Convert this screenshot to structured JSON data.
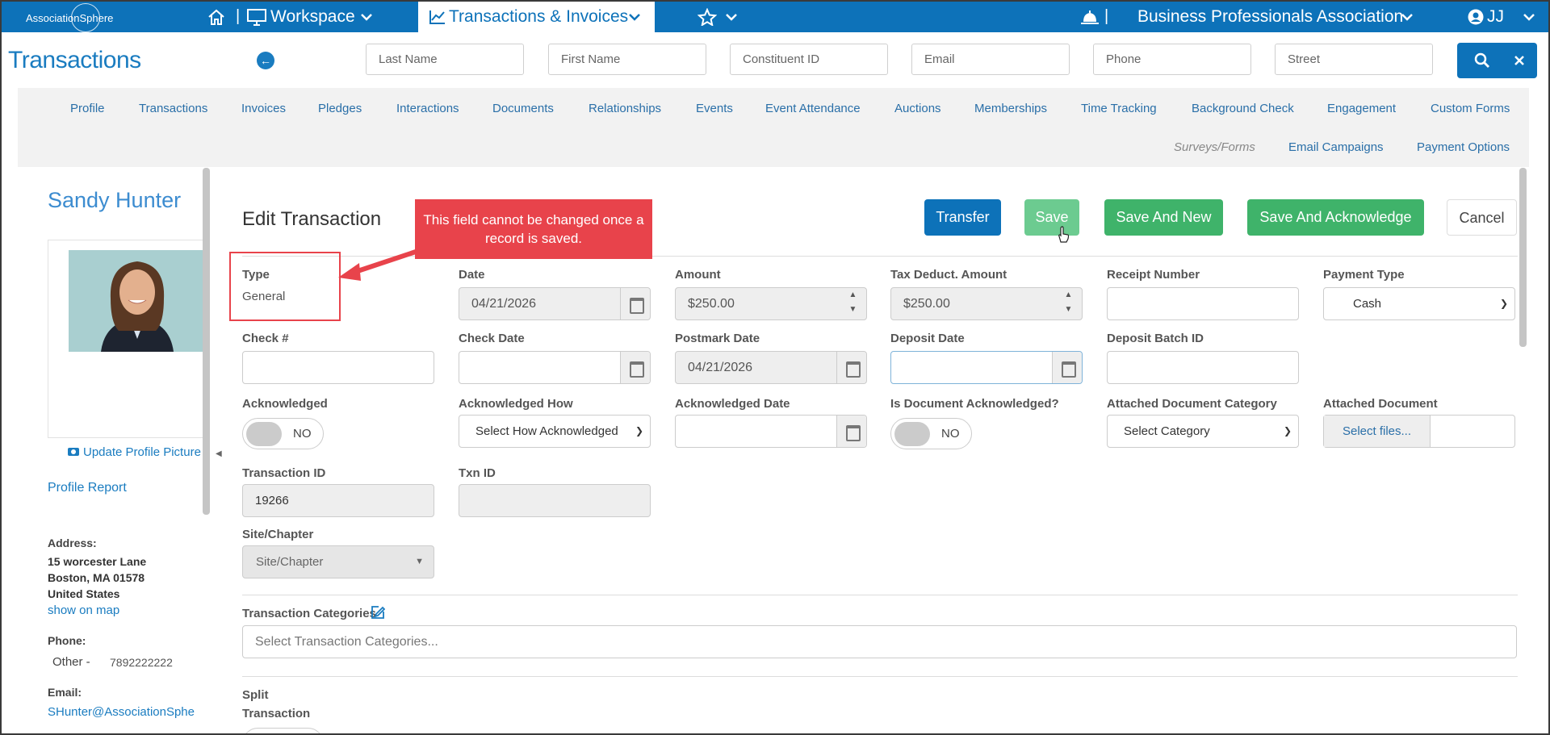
{
  "topnav": {
    "logo": "AssociationSphere",
    "workspace": "Workspace",
    "active_tab": "Transactions & Invoices",
    "org": "Business Professionals Association",
    "user_initials": "JJ"
  },
  "header": {
    "title": "Transactions",
    "search": {
      "last_name": "Last Name",
      "first_name": "First Name",
      "constituent_id": "Constituent ID",
      "email": "Email",
      "phone": "Phone",
      "street": "Street"
    }
  },
  "tabs": {
    "row1": [
      "Profile",
      "Transactions",
      "Invoices",
      "Pledges",
      "Interactions",
      "Documents",
      "Relationships",
      "Events",
      "Event Attendance",
      "Auctions",
      "Memberships",
      "Time Tracking",
      "Background Check",
      "Engagement",
      "Custom Forms"
    ],
    "row2": [
      "Surveys/Forms",
      "Email Campaigns",
      "Payment Options"
    ]
  },
  "profile": {
    "name": "Sandy Hunter",
    "update_picture": "Update Profile Picture",
    "profile_report": "Profile Report",
    "address_label": "Address:",
    "address1": "15 worcester Lane",
    "address2": "Boston, MA 01578",
    "address3": "United States",
    "show_map": "show on map",
    "phone_label": "Phone:",
    "phone_type": "Other -",
    "phone_number": "7892222222",
    "email_label": "Email:",
    "email": "SHunter@AssociationSphe"
  },
  "form": {
    "title": "Edit Transaction",
    "buttons": {
      "transfer": "Transfer",
      "save": "Save",
      "save_new": "Save And New",
      "save_ack": "Save And Acknowledge",
      "cancel": "Cancel"
    },
    "callout": "This field cannot be changed once a record is saved.",
    "type_label": "Type",
    "type_value": "General",
    "date_label": "Date",
    "date_value": "04/21/2026",
    "amount_label": "Amount",
    "amount_value": "$250.00",
    "tax_label": "Tax Deduct. Amount",
    "tax_value": "$250.00",
    "receipt_label": "Receipt Number",
    "payment_type_label": "Payment Type",
    "payment_type_value": "Cash",
    "check_label": "Check #",
    "check_date_label": "Check Date",
    "postmark_label": "Postmark Date",
    "postmark_value": "04/21/2026",
    "deposit_date_label": "Deposit Date",
    "deposit_batch_label": "Deposit Batch ID",
    "acknowledged_label": "Acknowledged",
    "acknowledged_value": "NO",
    "ack_how_label": "Acknowledged How",
    "ack_how_value": "Select How Acknowledged",
    "ack_date_label": "Acknowledged Date",
    "doc_ack_label": "Is Document Acknowledged?",
    "doc_ack_value": "NO",
    "doc_cat_label": "Attached Document Category",
    "doc_cat_value": "Select Category",
    "attached_doc_label": "Attached Document",
    "select_files": "Select files...",
    "txn_id_label": "Transaction ID",
    "txn_id_value": "19266",
    "txn_id2_label": "Txn ID",
    "site_label": "Site/Chapter",
    "site_value": "Site/Chapter",
    "categories_label": "Transaction Categories",
    "categories_placeholder": "Select Transaction Categories...",
    "split_label": "Split",
    "split_label2": "Transaction"
  },
  "colors": {
    "brand": "#0d72b9",
    "green": "#3fb36a",
    "callout": "#e8434b"
  }
}
